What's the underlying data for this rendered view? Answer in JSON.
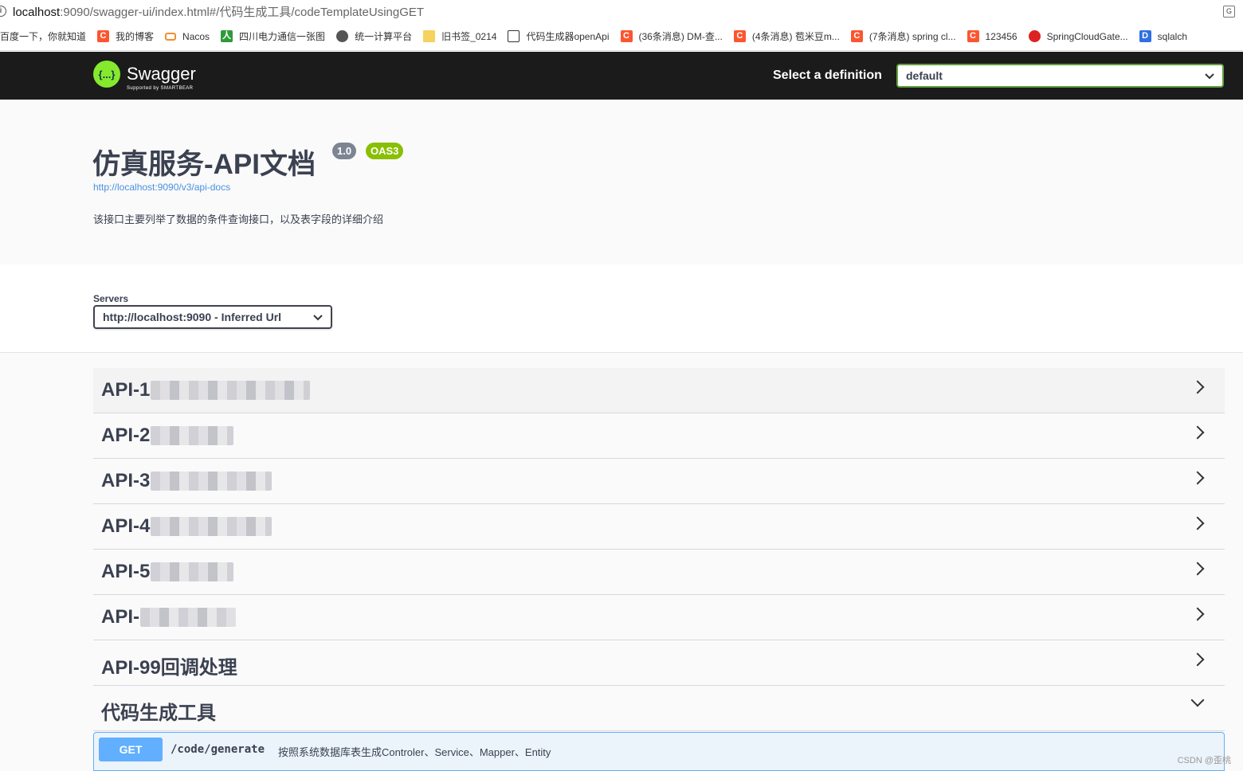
{
  "browser": {
    "url_host": "localhost",
    "url_rest": ":9090/swagger-ui/index.html#/代码生成工具/codeTemplateUsingGET",
    "bookmarks": [
      {
        "label": "百度一下，你就知道",
        "icon": "none"
      },
      {
        "label": "我的博客",
        "icon": "csdn-icon"
      },
      {
        "label": "Nacos",
        "icon": "nacos-icon"
      },
      {
        "label": "四川电力通信一张图",
        "icon": "green-icon"
      },
      {
        "label": "统一计算平台",
        "icon": "globe-icon"
      },
      {
        "label": "旧书签_0214",
        "icon": "folder-icon"
      },
      {
        "label": "代码生成器openApi",
        "icon": "image-icon"
      },
      {
        "label": "(36条消息) DM-查...",
        "icon": "csdn-icon"
      },
      {
        "label": "(4条消息) 苞米豆m...",
        "icon": "csdn-icon"
      },
      {
        "label": "(7条消息) spring cl...",
        "icon": "csdn-icon"
      },
      {
        "label": "123456",
        "icon": "csdn-icon"
      },
      {
        "label": "SpringCloudGate...",
        "icon": "spring-icon"
      },
      {
        "label": "sqlalch",
        "icon": "dl-icon"
      }
    ]
  },
  "topbar": {
    "logo_text": "Swagger",
    "logo_sub": "Supported by SMARTBEAR",
    "logo_glyph": "{...}",
    "definition_label": "Select a definition",
    "definition_value": "default"
  },
  "info": {
    "title": "仿真服务-API文档",
    "version": "1.0",
    "oas": "OAS3",
    "docs_url": "http://localhost:9090/v3/api-docs",
    "description": "该接口主要列举了数据的条件查询接口，以及表字段的详细介绍"
  },
  "servers": {
    "label": "Servers",
    "selected": "http://localhost:9090 - Inferred Url"
  },
  "tags": [
    {
      "name": "API-1"
    },
    {
      "name": "API-2"
    },
    {
      "name": "API-3"
    },
    {
      "name": "API-4"
    },
    {
      "name": "API-5"
    },
    {
      "name": "API-"
    },
    {
      "name": "API-99回调处理"
    },
    {
      "name": "代码生成工具"
    }
  ],
  "operation": {
    "method": "GET",
    "path": "/code/generate",
    "summary": "按照系统数据库表生成Controler、Service、Mapper、Entity"
  },
  "watermark": "CSDN @歪桃"
}
